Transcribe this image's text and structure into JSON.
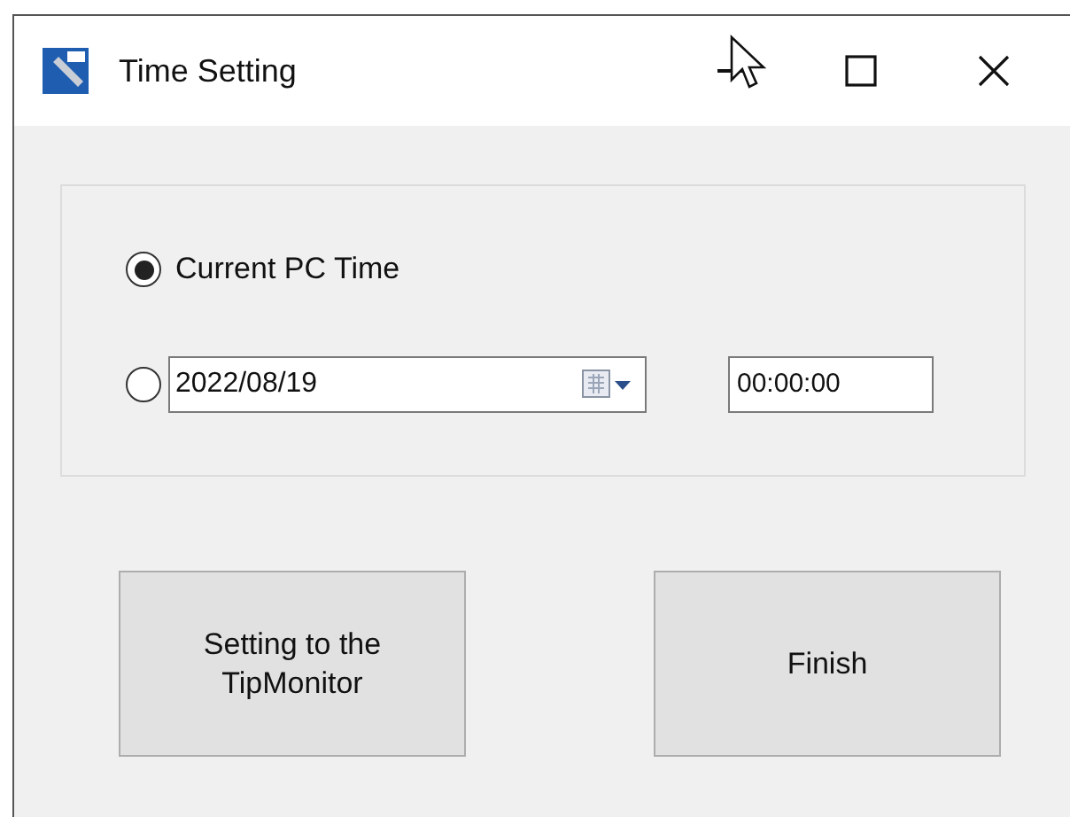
{
  "window": {
    "title": "Time Setting"
  },
  "options": [
    {
      "kind": "label",
      "label": "Current PC Time",
      "selected": true
    },
    {
      "kind": "datetime",
      "date": "2022/08/19",
      "time": "00:00:00",
      "selected": false
    }
  ],
  "buttons": [
    {
      "label": "Setting to the\nTipMonitor"
    },
    {
      "label": "Finish"
    }
  ]
}
